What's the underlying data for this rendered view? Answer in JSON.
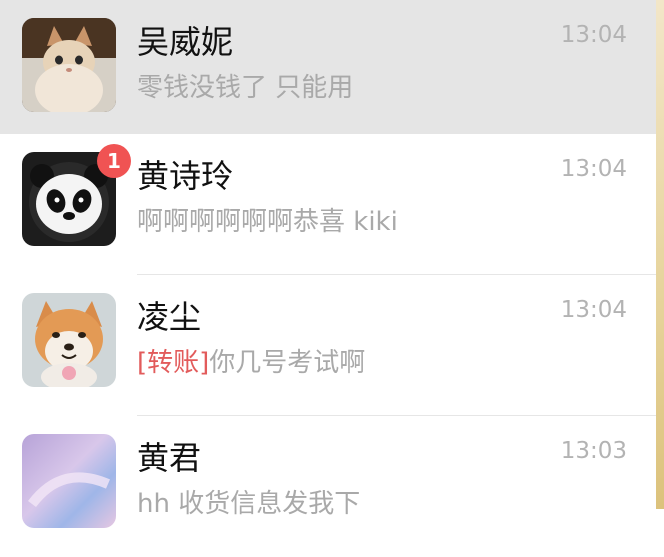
{
  "chats": [
    {
      "name": "吴威妮",
      "time": "13:04",
      "preview": "零钱没钱了 只能用",
      "avatar_icon": "cat-avatar-icon",
      "pinned": true
    },
    {
      "name": "黄诗玲",
      "time": "13:04",
      "preview": "啊啊啊啊啊啊恭喜 kiki",
      "avatar_icon": "panda-avatar-icon",
      "unread": "1"
    },
    {
      "name": "凌尘",
      "time": "13:04",
      "preview_tag": "[转账]",
      "preview": "你几号考试啊",
      "avatar_icon": "dog-avatar-icon"
    },
    {
      "name": "黄君",
      "time": "13:03",
      "preview": "hh 收货信息发我下",
      "avatar_icon": "iridescent-avatar-icon"
    }
  ],
  "colors": {
    "pinned_background": "#e5e5e5",
    "badge": "#f05353",
    "transfer_tag": "#e25b5b"
  }
}
